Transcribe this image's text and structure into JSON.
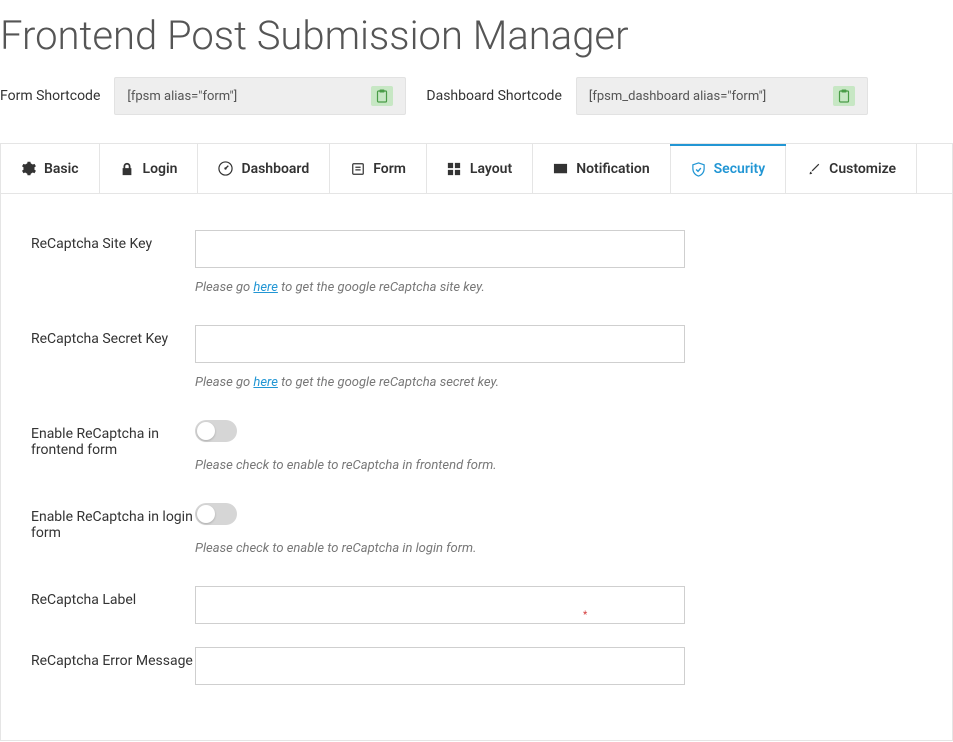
{
  "page": {
    "title": "Frontend Post Submission Manager"
  },
  "shortcodes": {
    "form_label": "Form Shortcode",
    "form_value": "[fpsm alias=\"form\"]",
    "dashboard_label": "Dashboard Shortcode",
    "dashboard_value": "[fpsm_dashboard alias=\"form\"]"
  },
  "tabs": {
    "basic": "Basic",
    "login": "Login",
    "dashboard": "Dashboard",
    "form": "Form",
    "layout": "Layout",
    "notification": "Notification",
    "security": "Security",
    "customize": "Customize"
  },
  "fields": {
    "site_key": {
      "label": "ReCaptcha Site Key",
      "value": "",
      "hint_pre": "Please go ",
      "hint_link": "here",
      "hint_post": " to get the google reCaptcha site key."
    },
    "secret_key": {
      "label": "ReCaptcha Secret Key",
      "value": "",
      "hint_pre": "Please go ",
      "hint_link": "here",
      "hint_post": " to get the google reCaptcha secret key."
    },
    "enable_frontend": {
      "label": "Enable ReCaptcha in frontend form",
      "hint": "Please check to enable to reCaptcha in frontend form."
    },
    "enable_login": {
      "label": "Enable ReCaptcha in login form",
      "hint": "Please check to enable to reCaptcha in login form."
    },
    "recaptcha_label": {
      "label": "ReCaptcha Label",
      "value": ""
    },
    "recaptcha_error": {
      "label": "ReCaptcha Error Message",
      "value": ""
    }
  }
}
